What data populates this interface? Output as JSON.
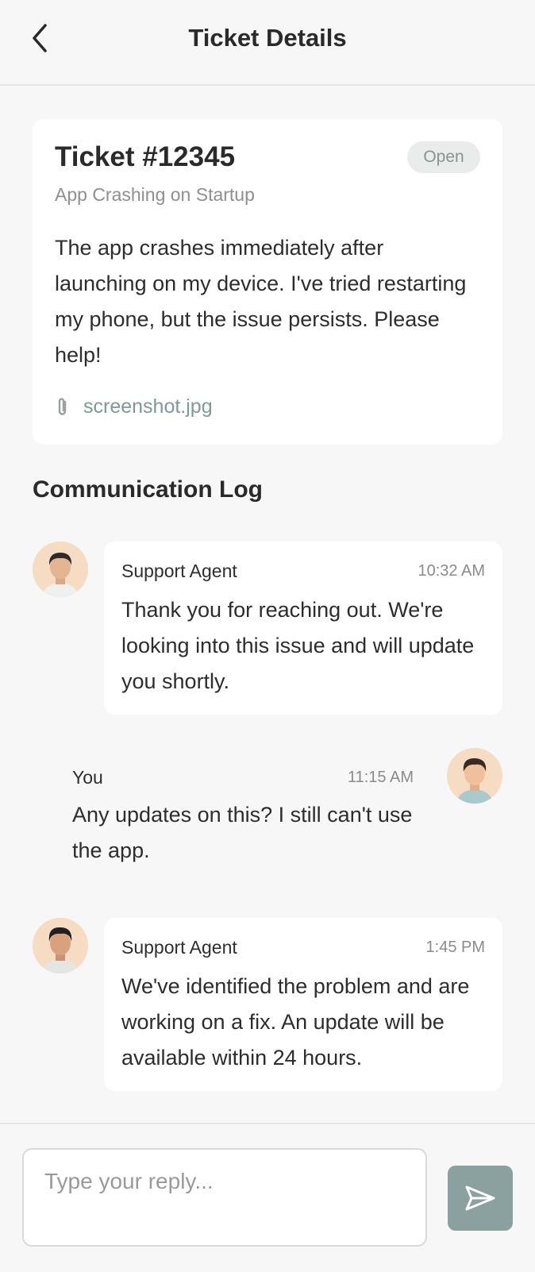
{
  "header": {
    "title": "Ticket Details",
    "back_icon": "chevron-left-icon"
  },
  "ticket": {
    "id": "Ticket #12345",
    "status": "Open",
    "subject": "App Crashing on Startup",
    "description": "The app crashes immediately after launching on my device. I've tried restarting my phone, but the issue persists. Please help!",
    "attachment": {
      "icon": "paperclip-icon",
      "name": "screenshot.jpg"
    }
  },
  "log": {
    "title": "Communication Log",
    "messages": [
      {
        "sender": "Support Agent",
        "time": "10:32 AM",
        "text": "Thank you for reaching out. We're looking into this issue and will update you shortly."
      },
      {
        "sender": "You",
        "time": "11:15 AM",
        "text": "Any updates on this? I still can't use the app."
      },
      {
        "sender": "Support Agent",
        "time": "1:45 PM",
        "text": "We've identified the problem and are working on a fix. An update will be available within 24 hours."
      }
    ]
  },
  "reply": {
    "placeholder": "Type your reply...",
    "send_icon": "send-icon"
  },
  "colors": {
    "accent": "#8aa19f",
    "attachment_link": "#7c9a96",
    "badge_bg": "#e9eceb",
    "avatar_bg": "#f7dcc4"
  }
}
